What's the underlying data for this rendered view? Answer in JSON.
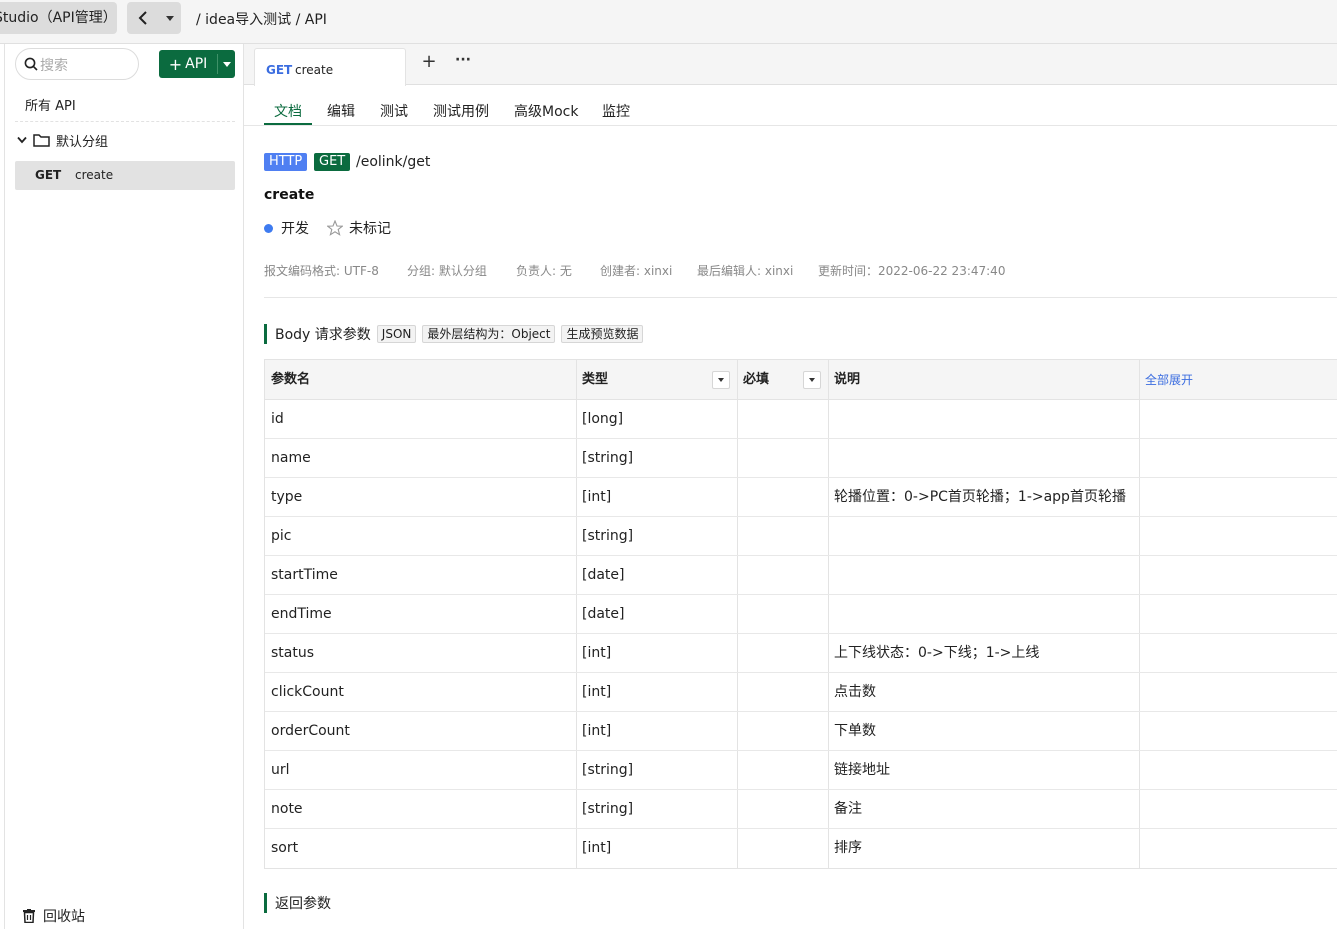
{
  "topbar": {
    "workspace": "Studio（API管理）",
    "breadcrumb": "/ idea导入测试 / API"
  },
  "sidebar": {
    "search_placeholder": "搜索",
    "add_api_label": "API",
    "all_api_label": "所有 API",
    "group_label": "默认分组",
    "items": [
      {
        "method": "GET",
        "name": "create"
      }
    ],
    "trash_label": "回收站"
  },
  "tabs": [
    {
      "method": "GET",
      "name": "create"
    }
  ],
  "subtabs": [
    "文档",
    "编辑",
    "测试",
    "测试用例",
    "高级Mock",
    "监控"
  ],
  "api": {
    "protocol": "HTTP",
    "method": "GET",
    "path": "/eolink/get",
    "name": "create",
    "status": "开发",
    "mark": "未标记",
    "meta": [
      "报文编码格式: UTF-8",
      "分组: 默认分组",
      "负责人: 无",
      "创建者: xinxi",
      "最后编辑人: xinxi",
      "更新时间：2022-06-22 23:47:40"
    ]
  },
  "body_params": {
    "title": "Body 请求参数",
    "chips": [
      "JSON",
      "最外层结构为：Object",
      "生成预览数据"
    ],
    "headers": {
      "name": "参数名",
      "type": "类型",
      "required": "必填",
      "desc": "说明",
      "expand_all": "全部展开"
    },
    "rows": [
      {
        "name": "id",
        "type": "[long]",
        "desc": ""
      },
      {
        "name": "name",
        "type": "[string]",
        "desc": ""
      },
      {
        "name": "type",
        "type": "[int]",
        "desc": "轮播位置：0->PC首页轮播；1->app首页轮播"
      },
      {
        "name": "pic",
        "type": "[string]",
        "desc": ""
      },
      {
        "name": "startTime",
        "type": "[date]",
        "desc": ""
      },
      {
        "name": "endTime",
        "type": "[date]",
        "desc": ""
      },
      {
        "name": "status",
        "type": "[int]",
        "desc": "上下线状态：0->下线；1->上线"
      },
      {
        "name": "clickCount",
        "type": "[int]",
        "desc": "点击数"
      },
      {
        "name": "orderCount",
        "type": "[int]",
        "desc": "下单数"
      },
      {
        "name": "url",
        "type": "[string]",
        "desc": "链接地址"
      },
      {
        "name": "note",
        "type": "[string]",
        "desc": "备注"
      },
      {
        "name": "sort",
        "type": "[int]",
        "desc": "排序"
      }
    ]
  },
  "return_params": {
    "title": "返回参数"
  },
  "colors": {
    "brand": "#0b6b3f",
    "http_badge": "#4f7ff2",
    "link": "#3b6de0",
    "status_dot": "#3e7bf0"
  }
}
